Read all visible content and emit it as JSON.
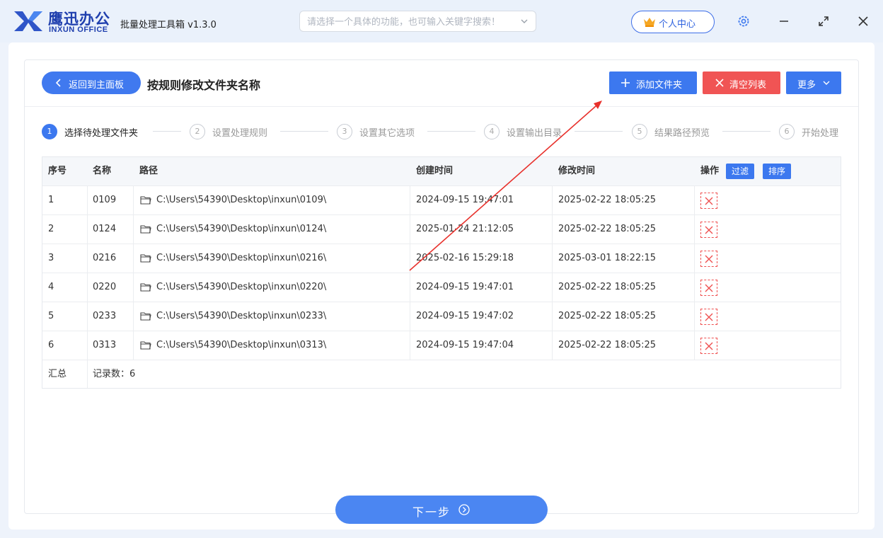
{
  "app": {
    "brand_cn": "鹰迅办公",
    "brand_en": "INXUN OFFICE",
    "title": "批量处理工具箱 v1.3.0",
    "search_placeholder": "请选择一个具体的功能，也可输入关键字搜索！",
    "user_center": "个人中心"
  },
  "header": {
    "back_label": "返回到主面板",
    "page_title": "按规则修改文件夹名称",
    "add_folder_label": "添加文件夹",
    "clear_list_label": "清空列表",
    "more_label": "更多"
  },
  "steps": [
    {
      "num": "1",
      "label": "选择待处理文件夹",
      "active": true
    },
    {
      "num": "2",
      "label": "设置处理规则",
      "active": false
    },
    {
      "num": "3",
      "label": "设置其它选项",
      "active": false
    },
    {
      "num": "4",
      "label": "设置输出目录",
      "active": false
    },
    {
      "num": "5",
      "label": "结果路径预览",
      "active": false
    },
    {
      "num": "6",
      "label": "开始处理",
      "active": false
    }
  ],
  "table": {
    "columns": [
      "序号",
      "名称",
      "路径",
      "创建时间",
      "修改时间",
      "操作"
    ],
    "filter_label": "过滤",
    "sort_label": "排序",
    "rows": [
      {
        "index": "1",
        "name": "0109",
        "path": "C:\\Users\\54390\\Desktop\\inxun\\0109\\",
        "created": "2024-09-15 19:47:01",
        "modified": "2025-02-22 18:05:25"
      },
      {
        "index": "2",
        "name": "0124",
        "path": "C:\\Users\\54390\\Desktop\\inxun\\0124\\",
        "created": "2025-01-24 21:12:05",
        "modified": "2025-02-22 18:05:25"
      },
      {
        "index": "3",
        "name": "0216",
        "path": "C:\\Users\\54390\\Desktop\\inxun\\0216\\",
        "created": "2025-02-16 15:29:18",
        "modified": "2025-03-01 18:22:15"
      },
      {
        "index": "4",
        "name": "0220",
        "path": "C:\\Users\\54390\\Desktop\\inxun\\0220\\",
        "created": "2024-09-15 19:47:01",
        "modified": "2025-02-22 18:05:25"
      },
      {
        "index": "5",
        "name": "0233",
        "path": "C:\\Users\\54390\\Desktop\\inxun\\0233\\",
        "created": "2024-09-15 19:47:02",
        "modified": "2025-02-22 18:05:25"
      },
      {
        "index": "6",
        "name": "0313",
        "path": "C:\\Users\\54390\\Desktop\\inxun\\0313\\",
        "created": "2024-09-15 19:47:04",
        "modified": "2025-02-22 18:05:25"
      }
    ],
    "summary_label": "汇总",
    "summary_value": "记录数：6"
  },
  "footer": {
    "next_label": "下一步"
  },
  "colors": {
    "primary": "#3c78ef",
    "danger": "#f05454",
    "annotation_arrow": "#e8312c"
  },
  "icons": [
    "logo-icon",
    "chevron-down-icon",
    "crown-icon",
    "gear-icon",
    "minimize-icon",
    "maximize-icon",
    "close-icon",
    "back-arrow-icon",
    "plus-icon",
    "x-icon",
    "folder-icon",
    "delete-icon",
    "arrow-right-circle-icon"
  ]
}
